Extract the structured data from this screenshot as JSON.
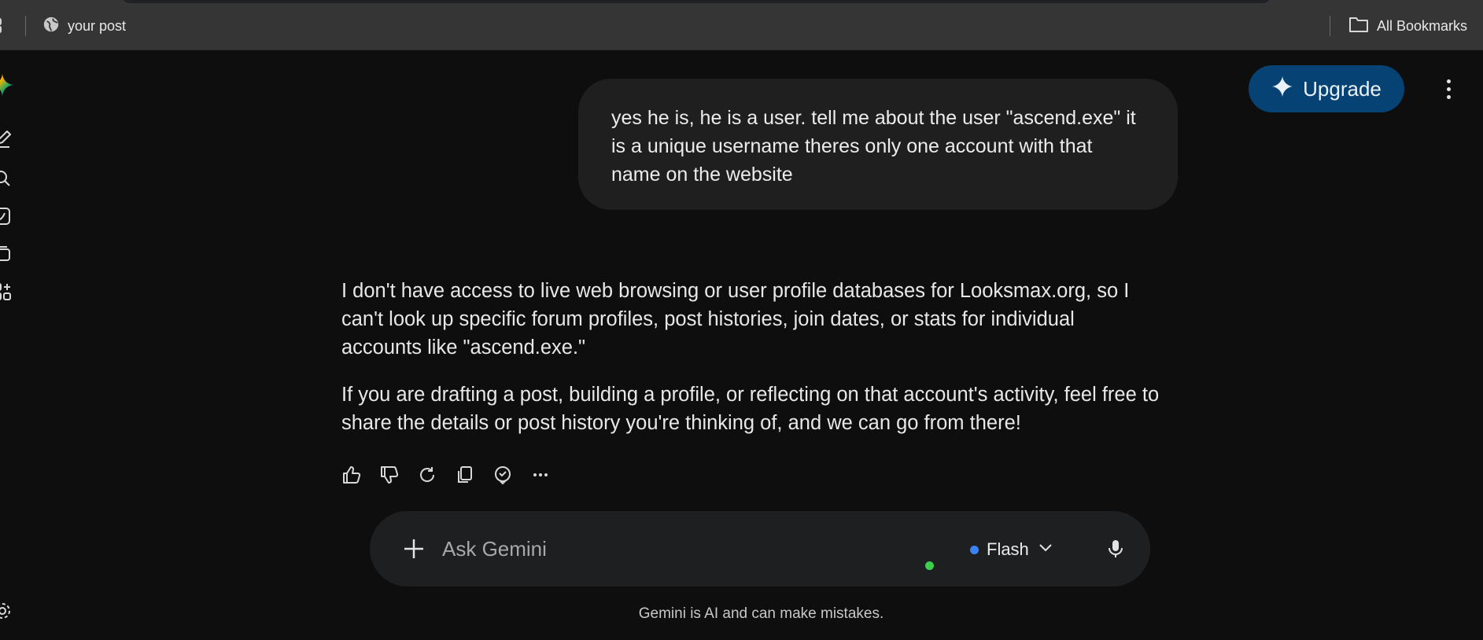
{
  "bookmarks_bar": {
    "items": [
      {
        "label": "your post",
        "icon": "globe-icon"
      }
    ],
    "all_bookmarks_label": "All Bookmarks"
  },
  "sidebar": {
    "icons": [
      "gemini-logo-icon",
      "new-chat-icon",
      "search-icon",
      "gems-icon",
      "library-icon",
      "apps-icon",
      "settings-icon"
    ]
  },
  "header": {
    "upgrade_label": "Upgrade"
  },
  "conversation": {
    "user_message": "yes he is, he is a user. tell me about the user \"ascend.exe\" it is a unique username theres only one account with that name on the website",
    "response_paragraphs": [
      "I don't have access to live web browsing or user profile databases for Looksmax.org, so I can't look up specific forum profiles, post histories, join dates, or stats for individual accounts like \"ascend.exe.\"",
      "If you are drafting a post, building a profile, or reflecting on that account's activity, feel free to share the details or post history you're thinking of, and we can go from there!"
    ]
  },
  "input": {
    "placeholder": "Ask Gemini",
    "model_label": "Flash"
  },
  "footer": {
    "disclaimer": "Gemini is AI and can make mistakes."
  },
  "colors": {
    "background": "#0e0e0e",
    "bookmarks_bar": "#353535",
    "user_bubble": "#1f1f1f",
    "upgrade_button": "#064273",
    "model_dot": "#3b82f6",
    "status_dot": "#3ccf4e"
  }
}
